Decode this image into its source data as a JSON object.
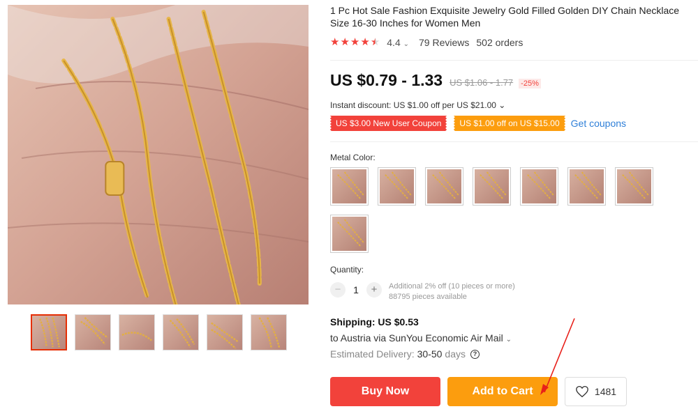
{
  "product": {
    "title": "1 Pc Hot Sale Fashion Exquisite Jewelry Gold Filled Golden DIY Chain Necklace Size 16-30 Inches for Women Men",
    "rating": "4.4",
    "rating_chevron": "⌄",
    "reviews": "79 Reviews",
    "orders": "502 orders",
    "stars": 4.4
  },
  "price": {
    "current": "US $0.79 - 1.33",
    "original": "US $1.06 - 1.77",
    "discount": "-25%"
  },
  "instant_discount": "Instant discount: US $1.00 off per US $21.00 ⌄",
  "coupons": {
    "new_user": "US $3.00 New User Coupon",
    "store": "US $1.00 off on US $15.00",
    "get_link": "Get coupons"
  },
  "metal_color": {
    "label": "Metal Color:",
    "count": 8
  },
  "quantity": {
    "label": "Quantity:",
    "minus": "−",
    "value": "1",
    "plus": "+",
    "additional": "Additional 2% off (10 pieces or more)",
    "available": "88795 pieces available"
  },
  "shipping": {
    "title": "Shipping: US $0.53",
    "destination": "to Austria via SunYou Economic Air Mail",
    "destination_chevron": "⌄",
    "estimated_label": "Estimated Delivery:",
    "estimated_days": "30-50",
    "estimated_unit": "days",
    "help": "?"
  },
  "actions": {
    "buy_now": "Buy Now",
    "add_to_cart": "Add to Cart",
    "wishlist_count": "1481"
  },
  "colors": {
    "accent_red": "#f2423b",
    "accent_orange": "#fc9d0e",
    "link_blue": "#2e7fd8"
  },
  "icons": [
    "star-icon",
    "chevron-down-icon",
    "help-icon",
    "heart-icon",
    "annotation-arrow"
  ]
}
